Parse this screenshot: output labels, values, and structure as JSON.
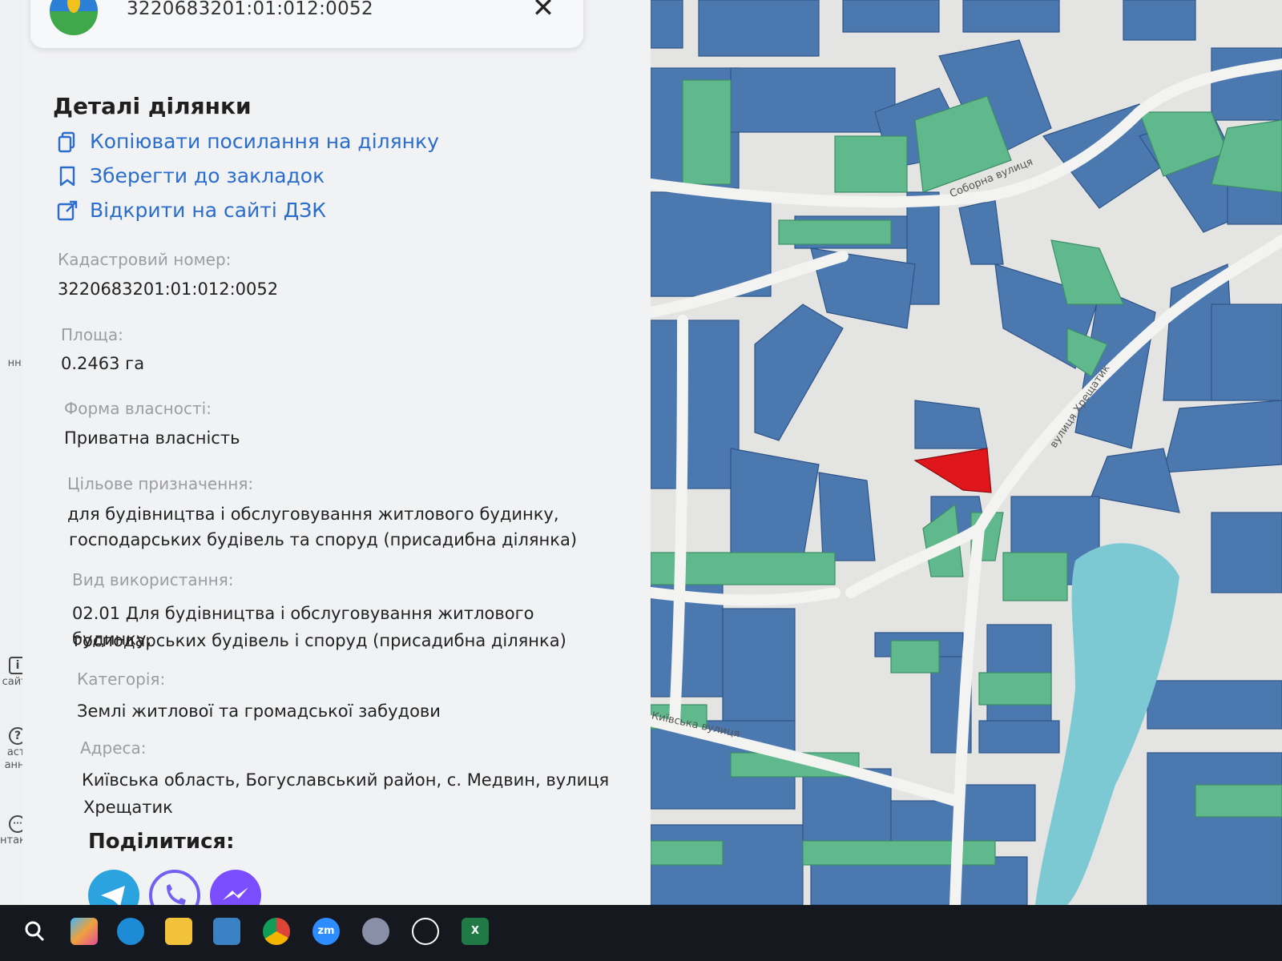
{
  "search": {
    "value": "3220683201:01:012:0052"
  },
  "panel": {
    "title": "Деталі ділянки",
    "actions": [
      {
        "label": "Копіювати посилання на ділянку",
        "icon": "copy-icon"
      },
      {
        "label": "Зберегти до закладок",
        "icon": "bookmark-icon"
      },
      {
        "label": "Відкрити на сайті ДЗК",
        "icon": "external-link-icon"
      }
    ],
    "fields": {
      "cadastral": {
        "label": "Кадастровий номер:",
        "value": "3220683201:01:012:0052"
      },
      "area": {
        "label": "Площа:",
        "value": "0.2463 га"
      },
      "ownership": {
        "label": "Форма власності:",
        "value": "Приватна власність"
      },
      "purpose": {
        "label": "Цільове призначення:",
        "value_line1": "для будівництва і обслуговування житлового будинку,",
        "value_line2": "господарських будівель та споруд (присадибна ділянка)"
      },
      "usage": {
        "label": "Вид використання:",
        "value_line1": "02.01 Для будівництва і обслуговування житлового будинку,",
        "value_line2": "господарських будівель і споруд (присадибна ділянка)"
      },
      "category": {
        "label": "Категорія:",
        "value": "Землі житлової та громадської забудови"
      },
      "address": {
        "label": "Адреса:",
        "value_line1": "Київська область, Богуславський район, с. Медвин, вулиця",
        "value_line2": "Хрещатик"
      }
    },
    "share": {
      "title": "Поділитися:",
      "buttons": [
        "telegram-icon",
        "viber-icon",
        "messenger-icon"
      ]
    }
  },
  "rail": {
    "items": [
      {
        "label": "ння",
        "icon": ""
      },
      {
        "label": "сайту",
        "icon": "info-icon"
      },
      {
        "label1": "асті",
        "label2": "ання",
        "icon": "help-icon"
      },
      {
        "label": "нтакти",
        "icon": "chat-icon"
      }
    ]
  },
  "map": {
    "streets": [
      "Соборна вулиця",
      "вулиця Хрещатик",
      "Київська вулиця"
    ],
    "colors": {
      "parcel_blue": "#4c78b0",
      "parcel_green": "#5fb98c",
      "selected": "#e0161d",
      "water": "#7cc9d4",
      "road": "#f3f3f1",
      "background": "#e4e4e2"
    }
  },
  "taskbar": {
    "apps": [
      {
        "name": "search-icon",
        "text": ""
      },
      {
        "name": "copilot-icon",
        "text": ""
      },
      {
        "name": "edge-icon",
        "text": ""
      },
      {
        "name": "file-explorer-icon",
        "text": ""
      },
      {
        "name": "store-icon",
        "text": ""
      },
      {
        "name": "chrome-icon",
        "text": ""
      },
      {
        "name": "zoom-icon",
        "text": "zm"
      },
      {
        "name": "app-icon",
        "text": ""
      },
      {
        "name": "chatgpt-icon",
        "text": ""
      },
      {
        "name": "excel-icon",
        "text": "X"
      }
    ]
  }
}
